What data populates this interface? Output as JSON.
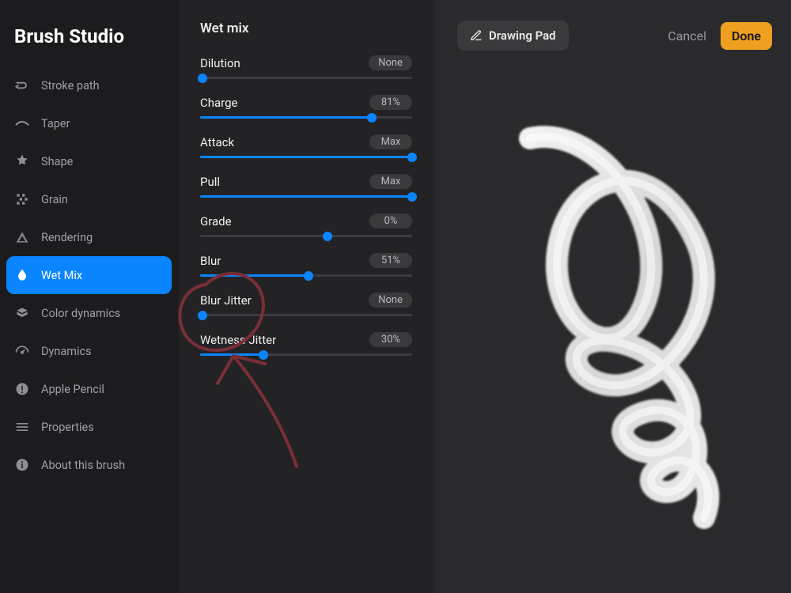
{
  "app": {
    "title": "Brush Studio"
  },
  "sidebar": {
    "items": [
      {
        "label": "Stroke path",
        "icon": "stroke-path-icon"
      },
      {
        "label": "Taper",
        "icon": "taper-icon"
      },
      {
        "label": "Shape",
        "icon": "shape-icon"
      },
      {
        "label": "Grain",
        "icon": "grain-icon"
      },
      {
        "label": "Rendering",
        "icon": "rendering-icon"
      },
      {
        "label": "Wet Mix",
        "icon": "wet-mix-icon",
        "active": true
      },
      {
        "label": "Color dynamics",
        "icon": "color-dynamics-icon"
      },
      {
        "label": "Dynamics",
        "icon": "dynamics-icon"
      },
      {
        "label": "Apple Pencil",
        "icon": "apple-pencil-icon"
      },
      {
        "label": "Properties",
        "icon": "properties-icon"
      },
      {
        "label": "About this brush",
        "icon": "about-icon"
      }
    ]
  },
  "settings": {
    "title": "Wet mix",
    "sliders": [
      {
        "key": "dilution",
        "label": "Dilution",
        "value_text": "None",
        "pct": 0
      },
      {
        "key": "charge",
        "label": "Charge",
        "value_text": "81%",
        "pct": 81
      },
      {
        "key": "attack",
        "label": "Attack",
        "value_text": "Max",
        "pct": 100
      },
      {
        "key": "pull",
        "label": "Pull",
        "value_text": "Max",
        "pct": 100
      },
      {
        "key": "grade",
        "label": "Grade",
        "value_text": "0%",
        "pct": 60,
        "fill": 0
      },
      {
        "key": "blur",
        "label": "Blur",
        "value_text": "51%",
        "pct": 51
      },
      {
        "key": "blur_jitter",
        "label": "Blur Jitter",
        "value_text": "None",
        "pct": 0
      },
      {
        "key": "wetness_jitter",
        "label": "Wetness Jitter",
        "value_text": "30%",
        "pct": 30
      }
    ]
  },
  "canvas": {
    "drawing_pad_label": "Drawing Pad",
    "cancel_label": "Cancel",
    "done_label": "Done"
  },
  "colors": {
    "accent": "#0a84ff",
    "done_button": "#f0a020",
    "annotation": "#7a2e36"
  }
}
